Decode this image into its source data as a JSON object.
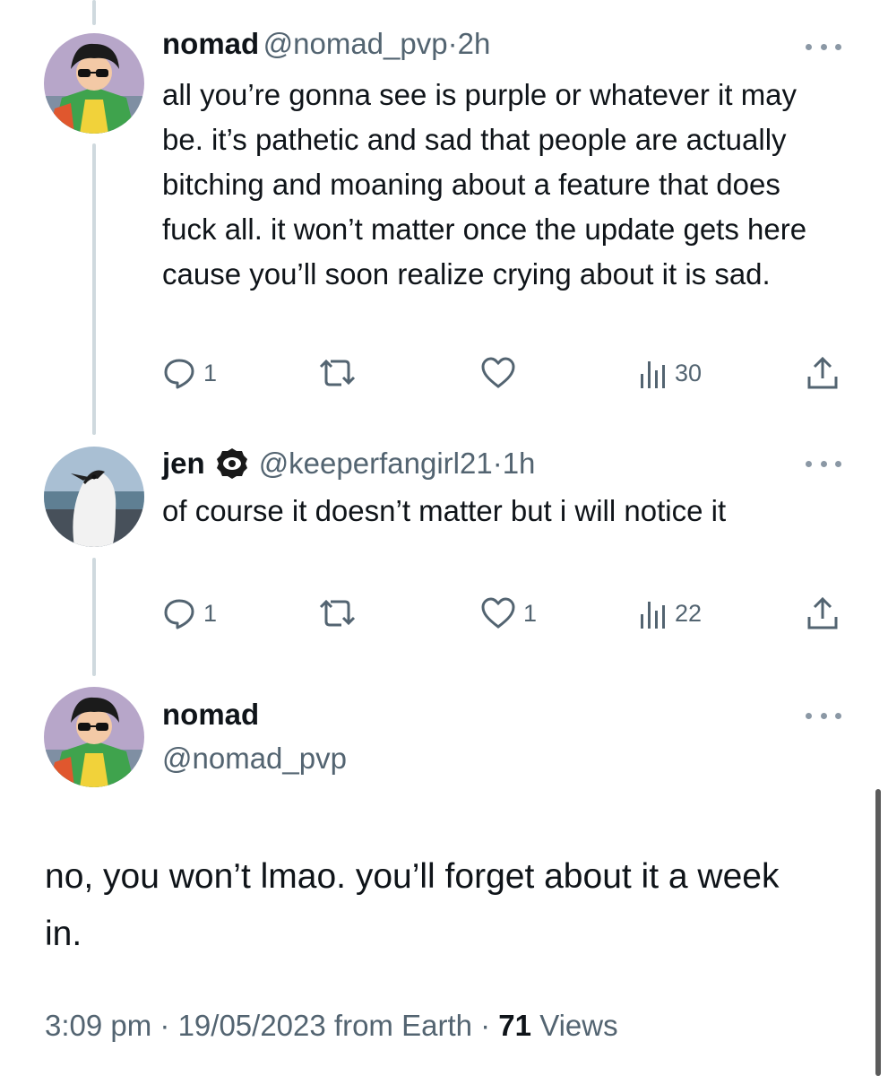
{
  "tweets": [
    {
      "name": "nomad",
      "handle": "@nomad_pvp",
      "sep": "·",
      "time": "2h",
      "text": "all you’re gonna see is purple or whatever it may be. it’s pathetic and sad that people are actually bitching and moaning about a feature that does fuck all. it won’t matter once the update gets here cause you’ll soon realize crying about it is sad.",
      "replies": "1",
      "retweets": "",
      "likes": "",
      "views": "30"
    },
    {
      "name": "jen",
      "handle": "@keeperfangirl21",
      "sep": "·",
      "time": "1h",
      "text": "of course it doesn’t matter but i will notice it",
      "replies": "1",
      "retweets": "",
      "likes": "1",
      "views": "22"
    }
  ],
  "focus": {
    "name": "nomad",
    "handle": "@nomad_pvp",
    "text": "no, you won’t lmao. you’ll forget about it a week in.",
    "time": "3:09 pm",
    "date": "19/05/2023",
    "source": "from Earth",
    "views_count": "71",
    "views_label": "Views"
  },
  "icons": [
    "reply-icon",
    "retweet-icon",
    "like-icon",
    "views-icon",
    "share-icon",
    "more-icon"
  ],
  "colors": {
    "text": "#0f1419",
    "secondary": "#536471",
    "thread": "#cfd9de"
  }
}
